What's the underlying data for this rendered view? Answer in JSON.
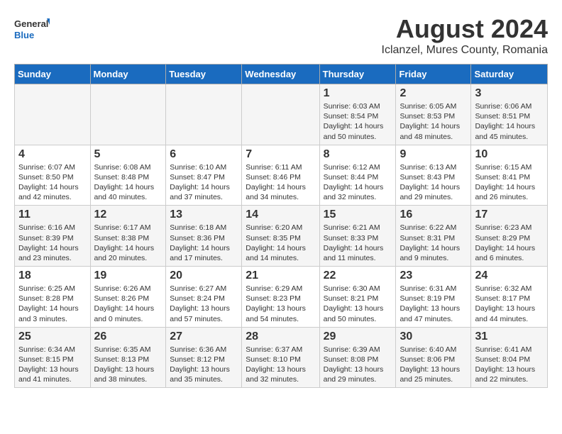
{
  "header": {
    "logo_general": "General",
    "logo_blue": "Blue",
    "title": "August 2024",
    "subtitle": "Iclanzel, Mures County, Romania"
  },
  "days_of_week": [
    "Sunday",
    "Monday",
    "Tuesday",
    "Wednesday",
    "Thursday",
    "Friday",
    "Saturday"
  ],
  "weeks": [
    [
      {
        "day": "",
        "info": ""
      },
      {
        "day": "",
        "info": ""
      },
      {
        "day": "",
        "info": ""
      },
      {
        "day": "",
        "info": ""
      },
      {
        "day": "1",
        "info": "Sunrise: 6:03 AM\nSunset: 8:54 PM\nDaylight: 14 hours and 50 minutes."
      },
      {
        "day": "2",
        "info": "Sunrise: 6:05 AM\nSunset: 8:53 PM\nDaylight: 14 hours and 48 minutes."
      },
      {
        "day": "3",
        "info": "Sunrise: 6:06 AM\nSunset: 8:51 PM\nDaylight: 14 hours and 45 minutes."
      }
    ],
    [
      {
        "day": "4",
        "info": "Sunrise: 6:07 AM\nSunset: 8:50 PM\nDaylight: 14 hours and 42 minutes."
      },
      {
        "day": "5",
        "info": "Sunrise: 6:08 AM\nSunset: 8:48 PM\nDaylight: 14 hours and 40 minutes."
      },
      {
        "day": "6",
        "info": "Sunrise: 6:10 AM\nSunset: 8:47 PM\nDaylight: 14 hours and 37 minutes."
      },
      {
        "day": "7",
        "info": "Sunrise: 6:11 AM\nSunset: 8:46 PM\nDaylight: 14 hours and 34 minutes."
      },
      {
        "day": "8",
        "info": "Sunrise: 6:12 AM\nSunset: 8:44 PM\nDaylight: 14 hours and 32 minutes."
      },
      {
        "day": "9",
        "info": "Sunrise: 6:13 AM\nSunset: 8:43 PM\nDaylight: 14 hours and 29 minutes."
      },
      {
        "day": "10",
        "info": "Sunrise: 6:15 AM\nSunset: 8:41 PM\nDaylight: 14 hours and 26 minutes."
      }
    ],
    [
      {
        "day": "11",
        "info": "Sunrise: 6:16 AM\nSunset: 8:39 PM\nDaylight: 14 hours and 23 minutes."
      },
      {
        "day": "12",
        "info": "Sunrise: 6:17 AM\nSunset: 8:38 PM\nDaylight: 14 hours and 20 minutes."
      },
      {
        "day": "13",
        "info": "Sunrise: 6:18 AM\nSunset: 8:36 PM\nDaylight: 14 hours and 17 minutes."
      },
      {
        "day": "14",
        "info": "Sunrise: 6:20 AM\nSunset: 8:35 PM\nDaylight: 14 hours and 14 minutes."
      },
      {
        "day": "15",
        "info": "Sunrise: 6:21 AM\nSunset: 8:33 PM\nDaylight: 14 hours and 11 minutes."
      },
      {
        "day": "16",
        "info": "Sunrise: 6:22 AM\nSunset: 8:31 PM\nDaylight: 14 hours and 9 minutes."
      },
      {
        "day": "17",
        "info": "Sunrise: 6:23 AM\nSunset: 8:29 PM\nDaylight: 14 hours and 6 minutes."
      }
    ],
    [
      {
        "day": "18",
        "info": "Sunrise: 6:25 AM\nSunset: 8:28 PM\nDaylight: 14 hours and 3 minutes."
      },
      {
        "day": "19",
        "info": "Sunrise: 6:26 AM\nSunset: 8:26 PM\nDaylight: 14 hours and 0 minutes."
      },
      {
        "day": "20",
        "info": "Sunrise: 6:27 AM\nSunset: 8:24 PM\nDaylight: 13 hours and 57 minutes."
      },
      {
        "day": "21",
        "info": "Sunrise: 6:29 AM\nSunset: 8:23 PM\nDaylight: 13 hours and 54 minutes."
      },
      {
        "day": "22",
        "info": "Sunrise: 6:30 AM\nSunset: 8:21 PM\nDaylight: 13 hours and 50 minutes."
      },
      {
        "day": "23",
        "info": "Sunrise: 6:31 AM\nSunset: 8:19 PM\nDaylight: 13 hours and 47 minutes."
      },
      {
        "day": "24",
        "info": "Sunrise: 6:32 AM\nSunset: 8:17 PM\nDaylight: 13 hours and 44 minutes."
      }
    ],
    [
      {
        "day": "25",
        "info": "Sunrise: 6:34 AM\nSunset: 8:15 PM\nDaylight: 13 hours and 41 minutes."
      },
      {
        "day": "26",
        "info": "Sunrise: 6:35 AM\nSunset: 8:13 PM\nDaylight: 13 hours and 38 minutes."
      },
      {
        "day": "27",
        "info": "Sunrise: 6:36 AM\nSunset: 8:12 PM\nDaylight: 13 hours and 35 minutes."
      },
      {
        "day": "28",
        "info": "Sunrise: 6:37 AM\nSunset: 8:10 PM\nDaylight: 13 hours and 32 minutes."
      },
      {
        "day": "29",
        "info": "Sunrise: 6:39 AM\nSunset: 8:08 PM\nDaylight: 13 hours and 29 minutes."
      },
      {
        "day": "30",
        "info": "Sunrise: 6:40 AM\nSunset: 8:06 PM\nDaylight: 13 hours and 25 minutes."
      },
      {
        "day": "31",
        "info": "Sunrise: 6:41 AM\nSunset: 8:04 PM\nDaylight: 13 hours and 22 minutes."
      }
    ]
  ]
}
